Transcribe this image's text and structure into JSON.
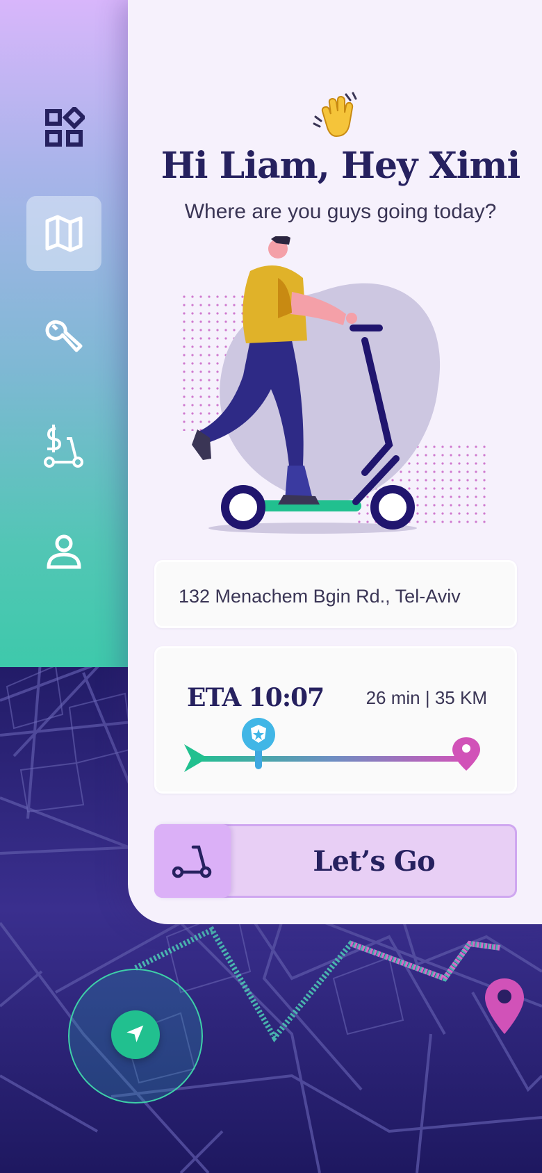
{
  "greeting": {
    "wave_icon": "waving-hand-icon",
    "title": "Hi Liam, Hey Ximi",
    "subtitle": "Where are you guys going today?"
  },
  "sidebar": {
    "items": [
      {
        "name": "dashboard",
        "icon": "dashboard-icon",
        "active": false
      },
      {
        "name": "map",
        "icon": "map-icon",
        "active": true
      },
      {
        "name": "service",
        "icon": "wrench-icon",
        "active": false
      },
      {
        "name": "rental-payment",
        "icon": "scooter-dollar-icon",
        "active": false
      },
      {
        "name": "profile",
        "icon": "user-icon",
        "active": false
      }
    ]
  },
  "address": {
    "value": "132 Menachem Bgin Rd., Tel-Aviv"
  },
  "eta": {
    "label": "ETA 10:07",
    "duration": "26 min",
    "separator": "|",
    "distance": "35 KM",
    "progress": 0.25
  },
  "action": {
    "label": "Let’s Go",
    "icon": "scooter-icon"
  },
  "map": {
    "locate_icon": "navigation-arrow-icon",
    "destination_icon": "location-pin-icon"
  },
  "colors": {
    "primary": "#26215f",
    "accent_green": "#21c08f",
    "accent_pink": "#d152b8",
    "accent_blue": "#41b6e6",
    "card_bg": "#f6f1fc",
    "button_bg": "#e8cff5"
  }
}
